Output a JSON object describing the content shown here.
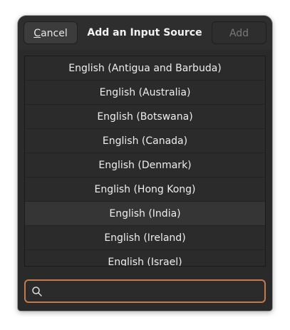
{
  "dialog": {
    "title": "Add an Input Source",
    "cancel_label_mnemonic": "C",
    "cancel_label_rest": "ancel",
    "add_label": "Add"
  },
  "list": {
    "items": [
      {
        "label": "English (Antigua and Barbuda)"
      },
      {
        "label": "English (Australia)"
      },
      {
        "label": "English (Botswana)"
      },
      {
        "label": "English (Canada)"
      },
      {
        "label": "English (Denmark)"
      },
      {
        "label": "English (Hong Kong)"
      },
      {
        "label": "English (India)",
        "selected": true
      },
      {
        "label": "English (Ireland)"
      },
      {
        "label": "English (Israel)"
      }
    ]
  },
  "search": {
    "value": "",
    "placeholder": "",
    "icon": "search-icon"
  },
  "colors": {
    "dialog_bg": "#2a2a2a",
    "accent_focus": "#c27a4a",
    "text": "#eeeeee",
    "disabled_text": "#7a7a7a"
  }
}
